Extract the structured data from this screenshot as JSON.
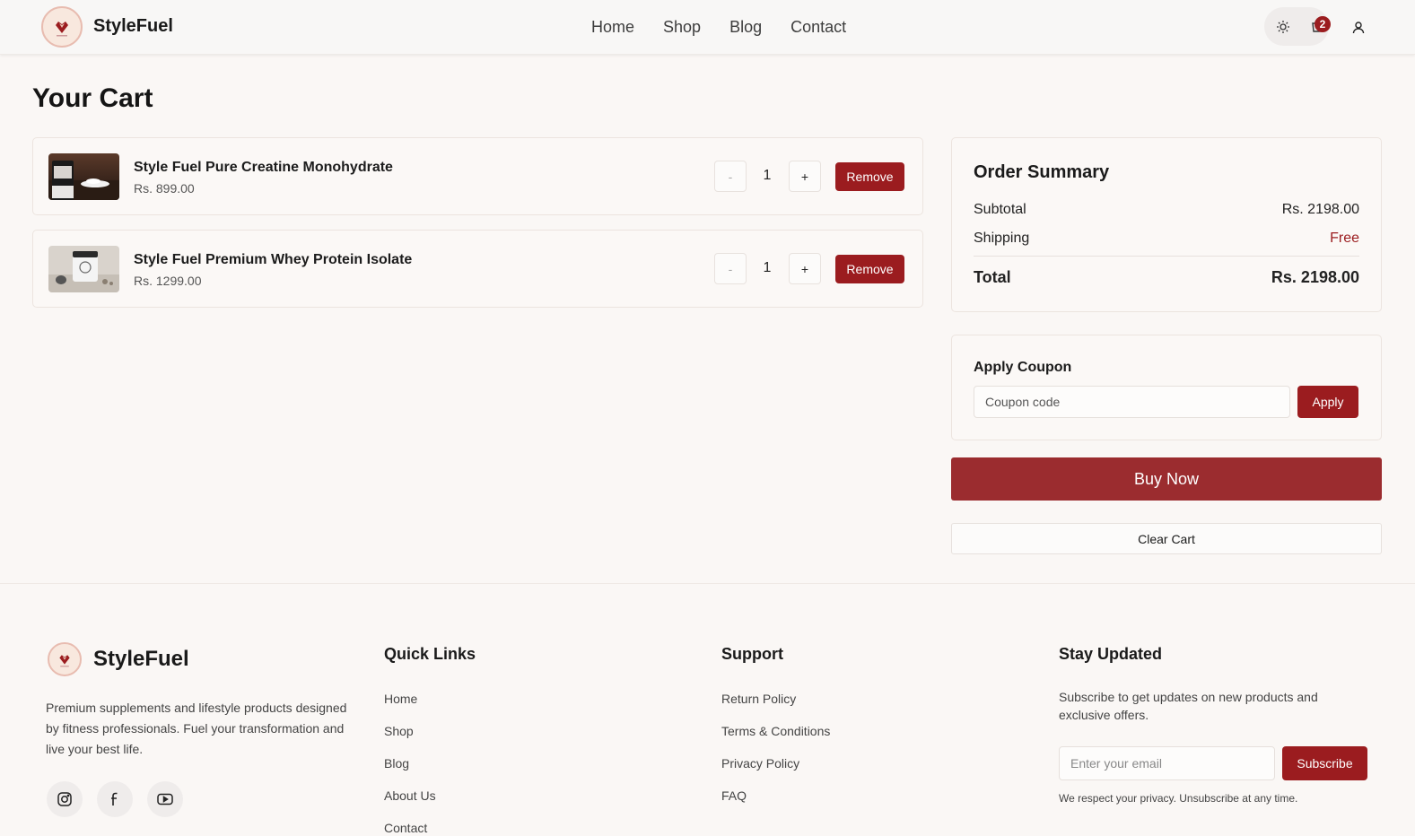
{
  "header": {
    "brand": "StyleFuel",
    "nav": [
      "Home",
      "Shop",
      "Blog",
      "Contact"
    ],
    "cart_count": "2",
    "icons": [
      "theme-toggle-icon",
      "cart-icon",
      "user-icon"
    ]
  },
  "page": {
    "title": "Your Cart"
  },
  "cart": {
    "items": [
      {
        "name": "Style Fuel Pure Creatine Monohydrate",
        "price": "Rs. 899.00",
        "qty": "1",
        "minus": "-",
        "plus": "+",
        "remove": "Remove"
      },
      {
        "name": "Style Fuel Premium Whey Protein Isolate",
        "price": "Rs. 1299.00",
        "qty": "1",
        "minus": "-",
        "plus": "+",
        "remove": "Remove"
      }
    ]
  },
  "summary": {
    "title": "Order Summary",
    "subtotal_label": "Subtotal",
    "subtotal_value": "Rs. 2198.00",
    "shipping_label": "Shipping",
    "shipping_value": "Free",
    "total_label": "Total",
    "total_value": "Rs. 2198.00"
  },
  "coupon": {
    "title": "Apply Coupon",
    "placeholder": "Coupon code",
    "apply_label": "Apply"
  },
  "actions": {
    "buy_now": "Buy Now",
    "clear_cart": "Clear Cart"
  },
  "footer": {
    "brand": "StyleFuel",
    "description": "Premium supplements and lifestyle products designed by fitness professionals. Fuel your transformation and live your best life.",
    "social": [
      "instagram-icon",
      "facebook-icon",
      "youtube-icon"
    ],
    "quick_links": {
      "title": "Quick Links",
      "links": [
        "Home",
        "Shop",
        "Blog",
        "About Us",
        "Contact"
      ]
    },
    "support": {
      "title": "Support",
      "links": [
        "Return Policy",
        "Terms & Conditions",
        "Privacy Policy",
        "FAQ"
      ]
    },
    "newsletter": {
      "title": "Stay Updated",
      "text": "Subscribe to get updates on new products and exclusive offers.",
      "placeholder": "Enter your email",
      "button": "Subscribe",
      "privacy": "We respect your privacy. Unsubscribe at any time."
    }
  },
  "colors": {
    "accent": "#9b1c1f",
    "background": "#faf7f5",
    "free_text": "#9b1c1f"
  }
}
